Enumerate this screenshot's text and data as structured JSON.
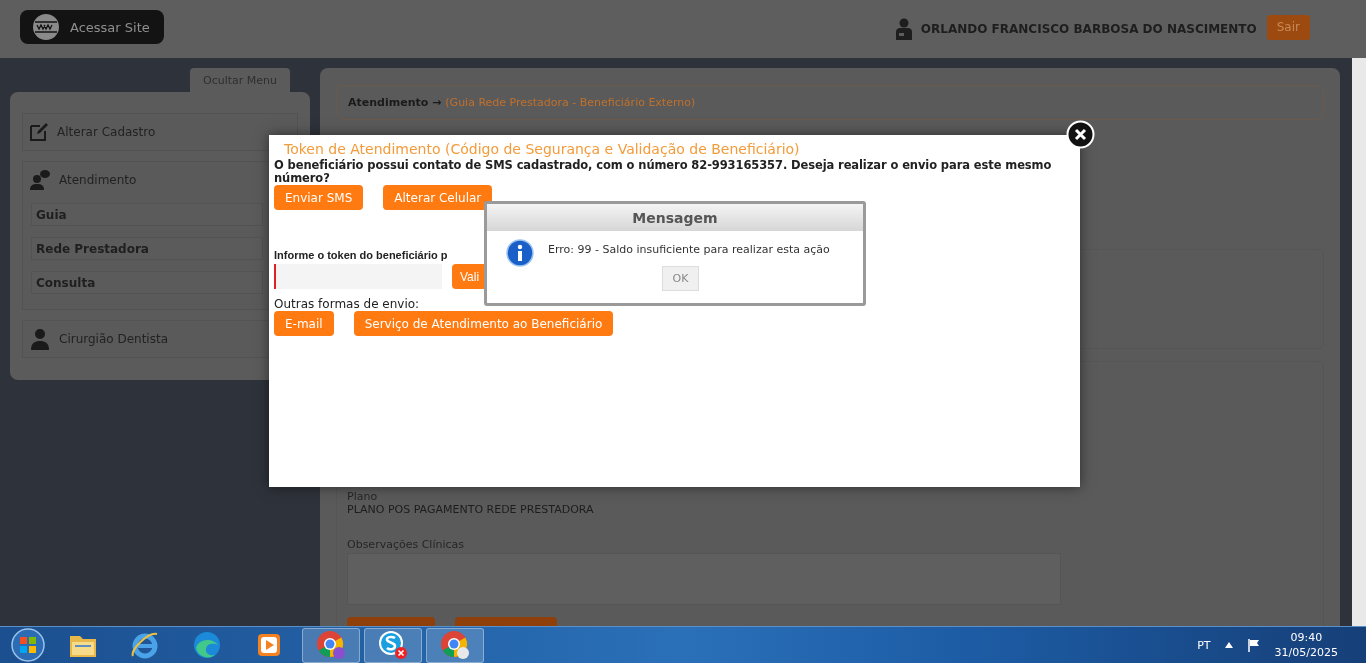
{
  "header": {
    "site_button": "Acessar Site",
    "user_name": "ORLANDO FRANCISCO BARBOSA DO NASCIMENTO",
    "logout_button": "Sair"
  },
  "sidebar": {
    "toggle": "Ocultar Menu",
    "items": [
      {
        "label": "Alterar Cadastro",
        "kind": "edit"
      },
      {
        "label": "Atendimento",
        "kind": "chat",
        "children": [
          {
            "label": "Guia"
          },
          {
            "label": "Rede Prestadora"
          },
          {
            "label": "Consulta"
          }
        ]
      },
      {
        "label": "Cirurgião Dentista",
        "kind": "person"
      }
    ]
  },
  "content": {
    "breadcrumb": {
      "section": "Atendimento →",
      "path": "(Guia Rede Prestadora - Beneficiário Externo)"
    },
    "plan": {
      "label": "Plano",
      "value": "PLANO POS PAGAMENTO REDE PRESTADORA"
    },
    "notes": {
      "label": "Observações Clínicas"
    }
  },
  "token_modal": {
    "title": "Token de Atendimento (Código de Segurança e Validação de Beneficiário)",
    "message": "O beneficiário possui contato de SMS cadastrado, com o número 82-993165357. Deseja realizar o envio para este mesmo número?",
    "sms_buttons": [
      "Enviar SMS",
      "Alterar Celular"
    ],
    "token_label": "Informe o token do beneficiário p",
    "validate_button": "Vali",
    "other_label": "Outras formas de envio:",
    "other_buttons": [
      "E-mail",
      "Serviço de Atendimento ao Beneficiário"
    ]
  },
  "message_dialog": {
    "title": "Mensagem",
    "text": "Erro: 99 - Saldo insuficiente para realizar esta ação",
    "ok_button": "OK"
  },
  "taskbar": {
    "apps": [
      {
        "kind": "folder"
      },
      {
        "kind": "ie"
      },
      {
        "kind": "edge"
      },
      {
        "kind": "media"
      },
      {
        "kind": "chrome_profile"
      },
      {
        "kind": "skype"
      },
      {
        "kind": "chrome_guest"
      }
    ],
    "language": "PT",
    "time": "09:40",
    "date": "31/05/2025"
  }
}
